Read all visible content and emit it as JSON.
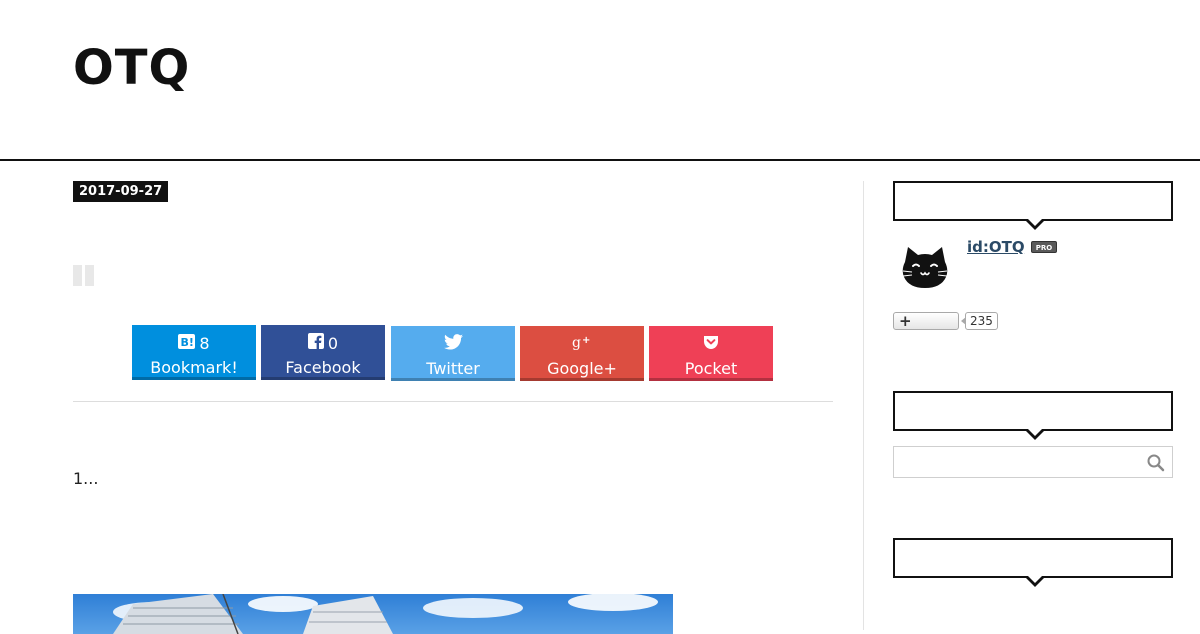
{
  "site": {
    "title": "OTQ"
  },
  "post": {
    "date": "2017-09-27",
    "body_text": "1..."
  },
  "share_buttons": [
    {
      "name": "hatena",
      "label": "Bookmark!",
      "count": "8",
      "icon": "hatena-b-icon",
      "color": "#008fde"
    },
    {
      "name": "facebook",
      "label": "Facebook",
      "count": "0",
      "icon": "facebook-icon",
      "color": "#305097"
    },
    {
      "name": "twitter",
      "label": "Twitter",
      "count": "",
      "icon": "twitter-bird-icon",
      "color": "#55acee"
    },
    {
      "name": "google-plus",
      "label": "Google+",
      "count": "",
      "icon": "google-plus-icon",
      "color": "#dc4e41"
    },
    {
      "name": "pocket",
      "label": "Pocket",
      "count": "",
      "icon": "pocket-icon",
      "color": "#ef4056"
    }
  ],
  "sidebar": {
    "profile": {
      "user_id": "id:OTQ",
      "badge": "PRO",
      "avatar_icon": "cat-face-icon",
      "follower_count": "235",
      "follow_icon": "plus-icon"
    },
    "search": {
      "placeholder": "",
      "icon": "search-icon"
    }
  },
  "colors": {
    "header_rule": "#111111",
    "date_badge_bg": "#111111",
    "divider": "#dddddd",
    "link": "#2b4a66"
  }
}
